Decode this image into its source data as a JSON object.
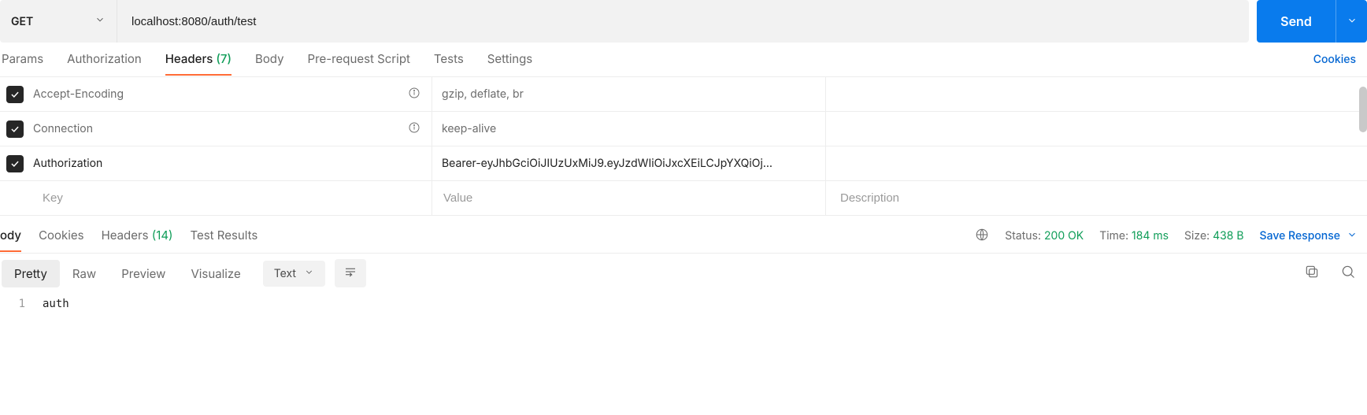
{
  "request": {
    "method": "GET",
    "url": "localhost:8080/auth/test",
    "send_label": "Send"
  },
  "req_tabs": {
    "params": "Params",
    "authorization": "Authorization",
    "headers": "Headers",
    "headers_count": "(7)",
    "body": "Body",
    "prerequest": "Pre-request Script",
    "tests": "Tests",
    "settings": "Settings",
    "cookies": "Cookies"
  },
  "headers_table": {
    "rows": [
      {
        "key": "Accept-Encoding",
        "value": "gzip, deflate, br",
        "info": true
      },
      {
        "key": "Connection",
        "value": "keep-alive",
        "info": true
      },
      {
        "key": "Authorization",
        "value": "Bearer-eyJhbGciOiJIUzUxMiJ9.eyJzdWIiOiJxcXEiLCJpYXQiOj…",
        "info": false
      }
    ],
    "key_ph": "Key",
    "value_ph": "Value",
    "desc_ph": "Description"
  },
  "resp_tabs": {
    "body": "ody",
    "cookies": "Cookies",
    "headers": "Headers",
    "headers_count": "(14)",
    "tests": "Test Results"
  },
  "resp_meta": {
    "status_label": "Status:",
    "status_value": "200 OK",
    "time_label": "Time:",
    "time_value": "184 ms",
    "size_label": "Size:",
    "size_value": "438 B",
    "save": "Save Response"
  },
  "view": {
    "pretty": "Pretty",
    "raw": "Raw",
    "preview": "Preview",
    "visualize": "Visualize",
    "lang": "Text"
  },
  "body_text": {
    "line1_no": "1",
    "line1": "auth"
  }
}
